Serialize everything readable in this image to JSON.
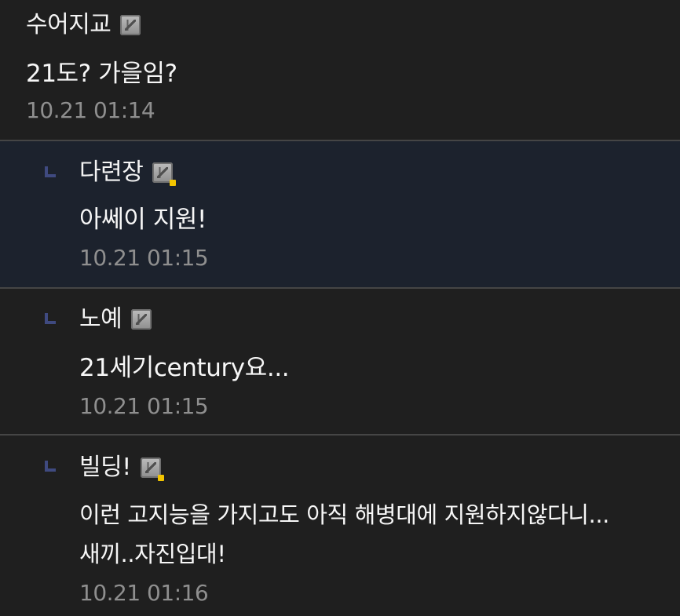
{
  "comments": [
    {
      "author": "수어지교",
      "icon": "user-level-icon",
      "text_lines": [
        "21도? 가을임?"
      ],
      "timestamp": "10.21 01:14"
    },
    {
      "author": "다련장",
      "icon": "user-level-icon-badge",
      "text_lines": [
        "아쎄이 지원!"
      ],
      "timestamp": "10.21 01:15"
    },
    {
      "author": "노예",
      "icon": "user-level-icon",
      "text_lines": [
        "21세기century요..."
      ],
      "timestamp": "10.21 01:15"
    },
    {
      "author": "빌딩!",
      "icon": "user-level-icon-badge",
      "text_lines": [
        "이런 고지능을 가지고도 아직 해병대에 지원하지않다니...",
        "새끼..자진입대!"
      ],
      "timestamp": "10.21 01:16"
    }
  ],
  "colors": {
    "background": "#1f1f1f",
    "highlight": "#1c222d",
    "divider": "#454545",
    "timestamp": "#8f8f8f",
    "reply_marker": "#3f4a80",
    "badge": "#f2c400"
  }
}
